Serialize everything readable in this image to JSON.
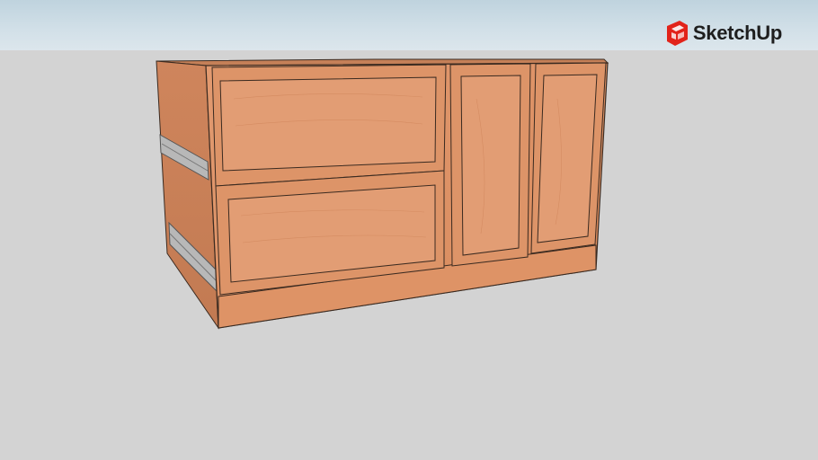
{
  "app": {
    "logo_text": "SketchUp",
    "logo_icon": "sketchup-logo-icon"
  },
  "scene": {
    "model": "cabinet-3d-model",
    "colors": {
      "sky": "#d2e0e8",
      "ground": "#d3d3d3",
      "wood_light": "#e0946a",
      "wood_mid": "#d88a5e",
      "wood_dark": "#c57a50",
      "wood_side": "#c9805a",
      "edge": "#3a2a20",
      "hardware": "#b8b8b8",
      "brand_red": "#e2231a"
    }
  }
}
